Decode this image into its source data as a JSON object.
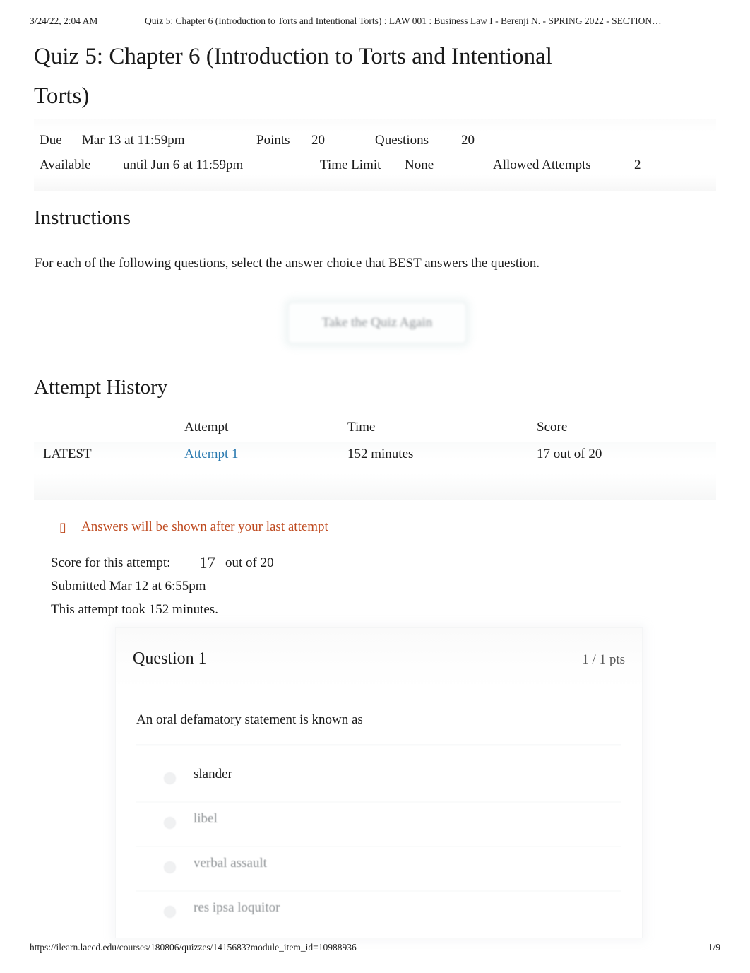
{
  "print_header": {
    "timestamp": "3/24/22, 2:04 AM",
    "document_title": "Quiz 5: Chapter 6 (Introduction to Torts and Intentional Torts) : LAW 001 : Business Law I - Berenji N. - SPRING 2022 - SECTION…"
  },
  "page_title": "Quiz 5: Chapter 6 (Introduction to Torts and Intentional Torts)",
  "quiz_meta": {
    "due_label": "Due",
    "due_value": "Mar 13 at 11:59pm",
    "points_label": "Points",
    "points_value": "20",
    "questions_label": "Questions",
    "questions_value": "20",
    "available_label": "Available",
    "available_value": "until Jun 6 at 11:59pm",
    "time_limit_label": "Time Limit",
    "time_limit_value": "None",
    "allowed_attempts_label": "Allowed Attempts",
    "allowed_attempts_value": "2"
  },
  "instructions": {
    "heading": "Instructions",
    "body": "For each of the following questions, select the answer choice that BEST answers the question."
  },
  "retake_button": {
    "label": "Take the Quiz Again"
  },
  "attempt_history": {
    "heading": "Attempt History",
    "columns": [
      "",
      "Attempt",
      "Time",
      "Score"
    ],
    "rows": [
      {
        "kept": "LATEST",
        "attempt": "Attempt 1",
        "time": "152 minutes",
        "score": "17 out of 20"
      }
    ]
  },
  "answers_notice": {
    "icon": "warning-icon",
    "icon_glyph": "▯",
    "text": "Answers will be shown after your last attempt",
    "color": "#bf4a1f"
  },
  "attempt_summary": {
    "score_label": "Score for this attempt:",
    "score_value": "17",
    "score_suffix": "out of 20",
    "submitted": "Submitted Mar 12 at 6:55pm",
    "duration": "This attempt took 152 minutes."
  },
  "question": {
    "title": "Question 1",
    "points": "1 / 1 pts",
    "text": "An oral defamatory statement is known as",
    "options": [
      {
        "label": "slander",
        "selected": true
      },
      {
        "label": "libel",
        "selected": false
      },
      {
        "label": "verbal assault",
        "selected": false
      },
      {
        "label": "res ipsa loquitor",
        "selected": false
      }
    ]
  },
  "print_footer": {
    "url": "https://ilearn.laccd.edu/courses/180806/quizzes/1415683?module_item_id=10988936",
    "page": "1/9"
  }
}
